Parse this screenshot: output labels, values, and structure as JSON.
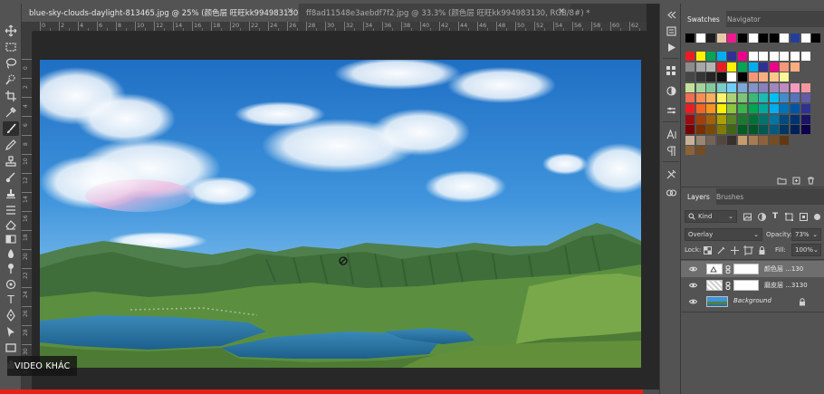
{
  "document_tabs": [
    {
      "label": "blue-sky-clouds-daylight-813465.jpg @ 25% (颜色层 旺旺kk994983130, RGB/8) *",
      "active": true
    },
    {
      "label": "ff8ad11548e3aebdf7f2.jpg @ 33.3% (颜色层 旺旺kk994983130, RGB/8#) *",
      "active": false
    }
  ],
  "ruler_h": [
    "0",
    "2",
    "4",
    "6",
    "8",
    "10",
    "12",
    "14",
    "16",
    "18",
    "20",
    "22",
    "24",
    "26",
    "28",
    "30",
    "32",
    "34",
    "36",
    "38",
    "40",
    "42",
    "44",
    "46",
    "48",
    "50",
    "52",
    "54",
    "56",
    "58",
    "60",
    "62",
    "64"
  ],
  "ruler_v": [
    "0",
    "2",
    "4",
    "6",
    "8",
    "10",
    "12",
    "14",
    "16",
    "18",
    "20",
    "22",
    "24",
    "26",
    "28",
    "30",
    "32"
  ],
  "swatch_panel": {
    "tabs": [
      "Swatches",
      "Navigator"
    ],
    "top_row": [
      "#000000",
      "#ffffff",
      "#1d1d1d",
      "#e7c9a9",
      "#ed1c8c",
      "#000000",
      "#ffffff",
      "#000000",
      "#000000",
      "#ffffff",
      "#253d9a",
      "#ffffff",
      "#000000"
    ],
    "rows": [
      [
        "#ed1c24",
        "#fff200",
        "#00a651",
        "#00aeef",
        "#2e3192",
        "#ec008c",
        "#ffffff",
        "#ffffff",
        "#ffffff",
        "#ffffff",
        "#ffffff",
        "#ffffff"
      ],
      [
        "#8c8c8c",
        "#a6a6a6",
        "#b5b5b5",
        "#ed1c24",
        "#fff200",
        "#00a651",
        "#00aeef",
        "#2e3192",
        "#ec008c",
        "#f7977a",
        "#fbad82"
      ],
      [
        "#464646",
        "#363636",
        "#252525",
        "#111111",
        "#ffffff",
        "#000000",
        "#f69679",
        "#f9ad81",
        "#fdc68a",
        "#fff79a"
      ],
      [
        "#c4df9b",
        "#a3d39c",
        "#82ca9c",
        "#7accc8",
        "#6dcff6",
        "#7da7d9",
        "#8393ca",
        "#8781bd",
        "#a186be",
        "#bd8cbf",
        "#f49ac1",
        "#f5989d"
      ],
      [
        "#f26c4f",
        "#f68e56",
        "#fbaf5d",
        "#fff568",
        "#acd373",
        "#7cc576",
        "#3bb878",
        "#1abbb4",
        "#00bff3",
        "#438ccb",
        "#5574b9",
        "#605ca8"
      ],
      [
        "#ed1c24",
        "#f26522",
        "#f7941d",
        "#fff200",
        "#8dc63f",
        "#39b54a",
        "#00a651",
        "#00a99d",
        "#00aeef",
        "#0072bc",
        "#0054a6",
        "#2e3192"
      ],
      [
        "#9e0b0f",
        "#a0410d",
        "#a36209",
        "#aba000",
        "#598527",
        "#1a7b30",
        "#007236",
        "#00746b",
        "#0076a3",
        "#004b80",
        "#003471",
        "#1b1464"
      ],
      [
        "#790000",
        "#7b2e00",
        "#7d4900",
        "#827b00",
        "#406618",
        "#005e20",
        "#005826",
        "#005952",
        "#005b7f",
        "#003663",
        "#002157",
        "#0d004c"
      ],
      [
        "#c7b299",
        "#998675",
        "#736357",
        "#534741",
        "#37302d",
        "#c69c6d",
        "#a67c52",
        "#8c6239",
        "#754c24",
        "#603913"
      ],
      [
        "#8c6239",
        "#754c24"
      ]
    ]
  },
  "layers_panel": {
    "tabs": [
      "Layers",
      "Brushes"
    ],
    "filter_label": "Kind",
    "blend_mode": "Overlay",
    "opacity_label": "Opacity:",
    "opacity_value": "73%",
    "lock_label": "Lock:",
    "fill_label": "Fill:",
    "fill_value": "100%",
    "layers": [
      {
        "name": "颜色层 ...130",
        "selected": true,
        "visible": true
      },
      {
        "name": "磨皮层 ...3130",
        "selected": false,
        "visible": true
      },
      {
        "name": "Background",
        "selected": false,
        "visible": true
      }
    ]
  },
  "video_overlay": {
    "label": "VIDEO KHÁC",
    "progress_fraction": 0.78
  },
  "colors": {
    "chrome": "#535353",
    "tab_strip": "#3a3a3a",
    "canvas_bg": "#282828",
    "progress": "#e62117"
  }
}
